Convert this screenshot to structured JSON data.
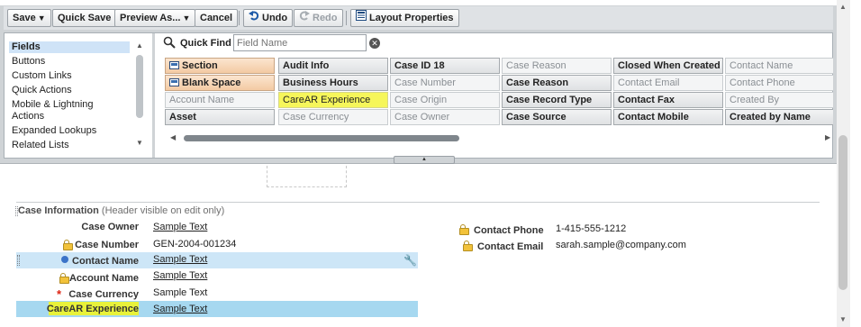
{
  "toolbar": {
    "save": "Save",
    "quick_save": "Quick Save",
    "preview_as": "Preview As...",
    "cancel": "Cancel",
    "undo": "Undo",
    "redo": "Redo",
    "layout_properties": "Layout Properties"
  },
  "palette": {
    "categories": [
      "Fields",
      "Buttons",
      "Custom Links",
      "Quick Actions",
      "Mobile & Lightning",
      "Actions",
      "Expanded Lookups",
      "Related Lists"
    ],
    "quick_find": {
      "label": "Quick Find",
      "placeholder": "Field Name",
      "value": ""
    },
    "grid": [
      [
        "Section",
        "Audit Info",
        "Case ID 18",
        "Case Reason",
        "Closed When Created",
        "Contact Name"
      ],
      [
        "Blank Space",
        "Business Hours",
        "Case Number",
        "Case Reason",
        "Contact Email",
        "Contact Phone"
      ],
      [
        "Account Name",
        "CareAR Experience",
        "Case Origin",
        "Case Record Type",
        "Contact Fax",
        "Created By"
      ],
      [
        "Asset",
        "Case Currency",
        "Case Owner",
        "Case Source",
        "Contact Mobile",
        "Created by Name"
      ]
    ]
  },
  "section": {
    "title": "Case Information",
    "note": "(Header visible on edit only)"
  },
  "left_fields": [
    {
      "label": "Case Owner",
      "value": "Sample Text"
    },
    {
      "label": "Case Number",
      "value": "GEN-2004-001234"
    },
    {
      "label": "Contact Name",
      "value": "Sample Text"
    },
    {
      "label": "Account Name",
      "value": "Sample Text"
    },
    {
      "label": "Case Currency",
      "value": "Sample Text"
    },
    {
      "label": "CareAR Experience",
      "value": "Sample Text"
    }
  ],
  "right_fields": [
    {
      "label": "Contact Phone",
      "value": "1-415-555-1212"
    },
    {
      "label": "Contact Email",
      "value": "sarah.sample@company.com"
    }
  ],
  "colors": {
    "highlight_yellow": "#f6f65a",
    "selected_row": "#a6d8f0",
    "hover_row": "#cde6f7",
    "required": "#dd2211"
  }
}
